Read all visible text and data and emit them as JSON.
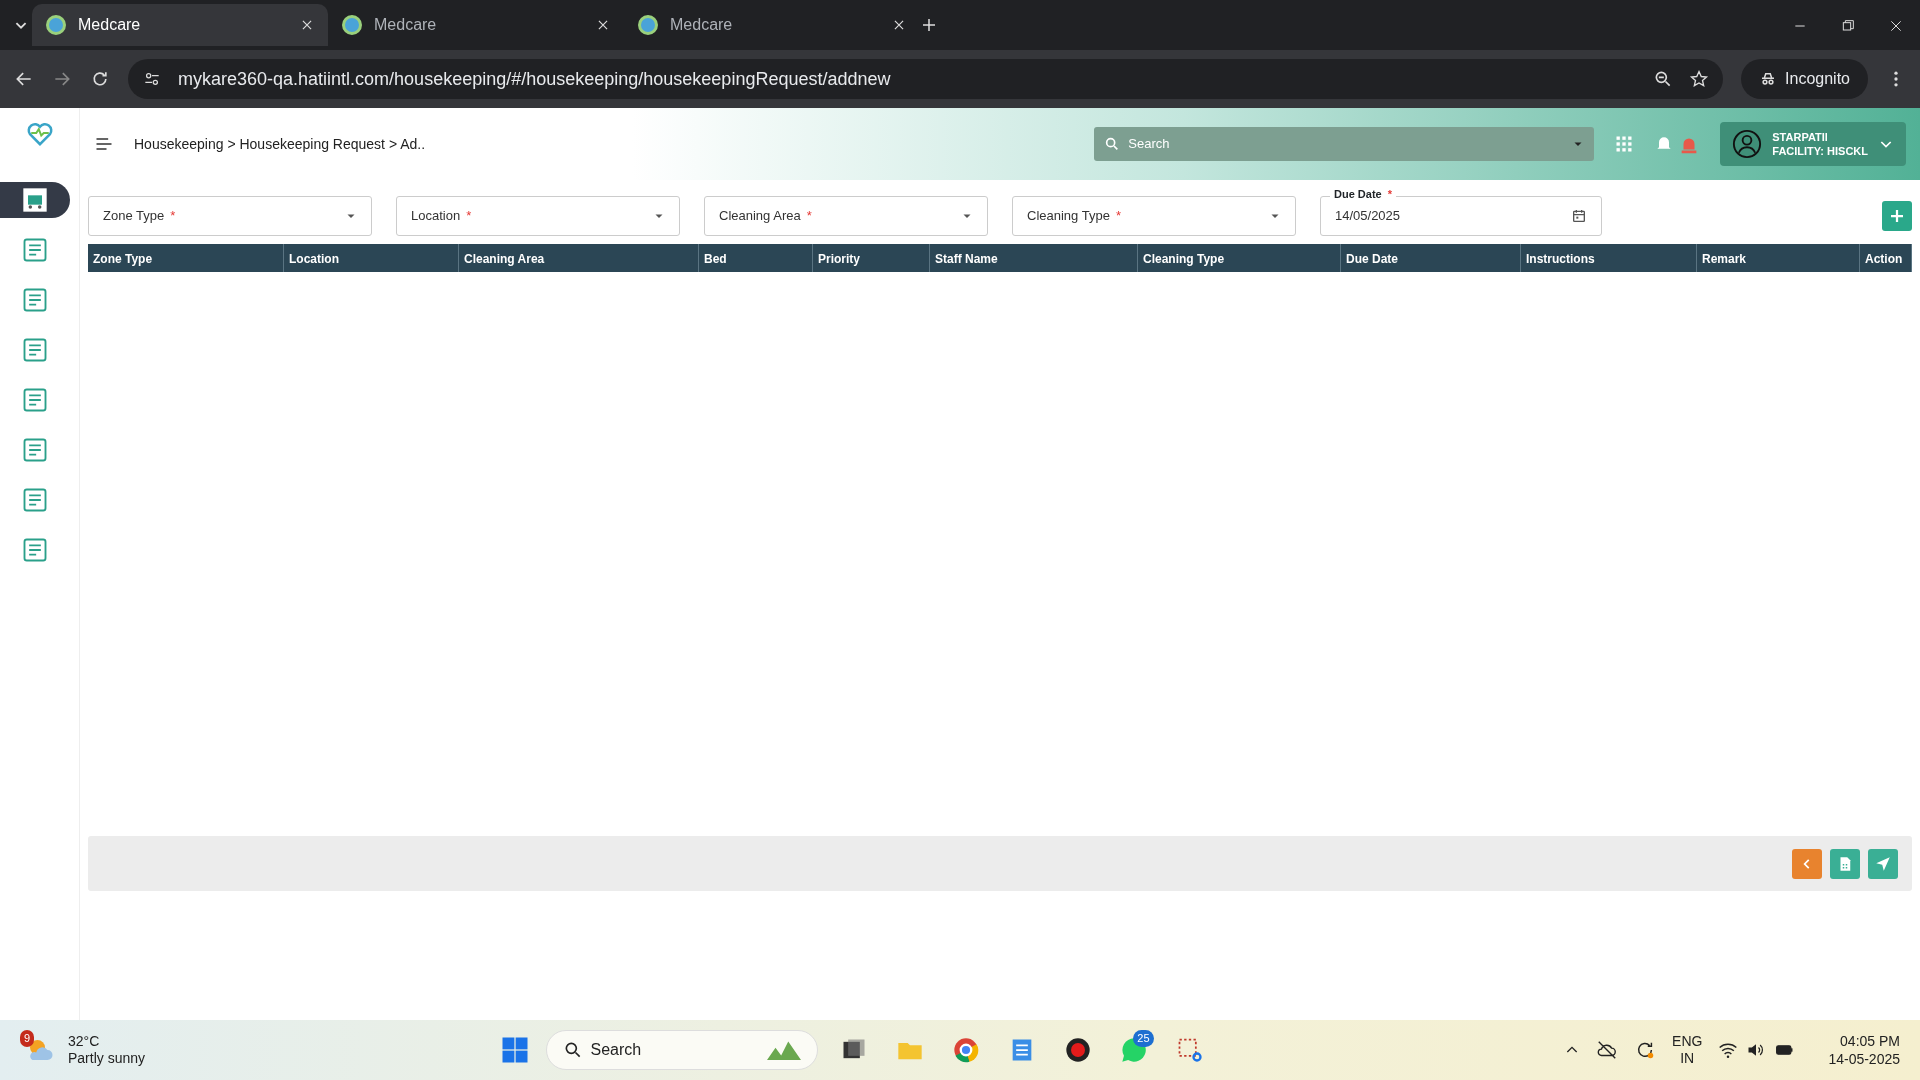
{
  "browser": {
    "tabs": [
      {
        "title": "Medcare",
        "selected": true
      },
      {
        "title": "Medcare",
        "selected": false
      },
      {
        "title": "Medcare",
        "selected": false
      }
    ],
    "url": "mykare360-qa.hatiintl.com/housekeeping/#/housekeeping/housekeepingRequest/addnew",
    "profile": "Incognito"
  },
  "header": {
    "breadcrumb": "Housekeeping > Housekeeping Request > Ad..",
    "search_placeholder": "Search",
    "user": {
      "name": "STARPATIl",
      "facility": "FACILITY: HISCKL"
    }
  },
  "sidebar": {
    "items": [
      {
        "selected": true
      },
      {
        "selected": false
      },
      {
        "selected": false
      },
      {
        "selected": false
      },
      {
        "selected": false
      },
      {
        "selected": false
      },
      {
        "selected": false
      },
      {
        "selected": false
      }
    ]
  },
  "filters": [
    {
      "kind": "select",
      "label": "Zone Type",
      "required_mark": "*"
    },
    {
      "kind": "select",
      "label": "Location",
      "required_mark": "*"
    },
    {
      "kind": "select",
      "label": "Cleaning Area",
      "required_mark": "*"
    },
    {
      "kind": "select",
      "label": "Cleaning Type",
      "required_mark": "*"
    },
    {
      "kind": "date",
      "label": "Due Date",
      "required_mark": "*",
      "value": "14/05/2025"
    }
  ],
  "table": {
    "columns": [
      "Zone Type",
      "Location",
      "Cleaning Area",
      "Bed",
      "Priority",
      "Staff Name",
      "Cleaning Type",
      "Due Date",
      "Instructions",
      "Remark",
      "Action"
    ]
  },
  "taskbar": {
    "weather": {
      "badge": "9",
      "temp": "32°C",
      "desc": "Partly sunny"
    },
    "search_placeholder": "Search",
    "whatsapp_badge": "25",
    "lang": "ENG",
    "region": "IN",
    "time": "04:05 PM",
    "date": "14-05-2025"
  }
}
